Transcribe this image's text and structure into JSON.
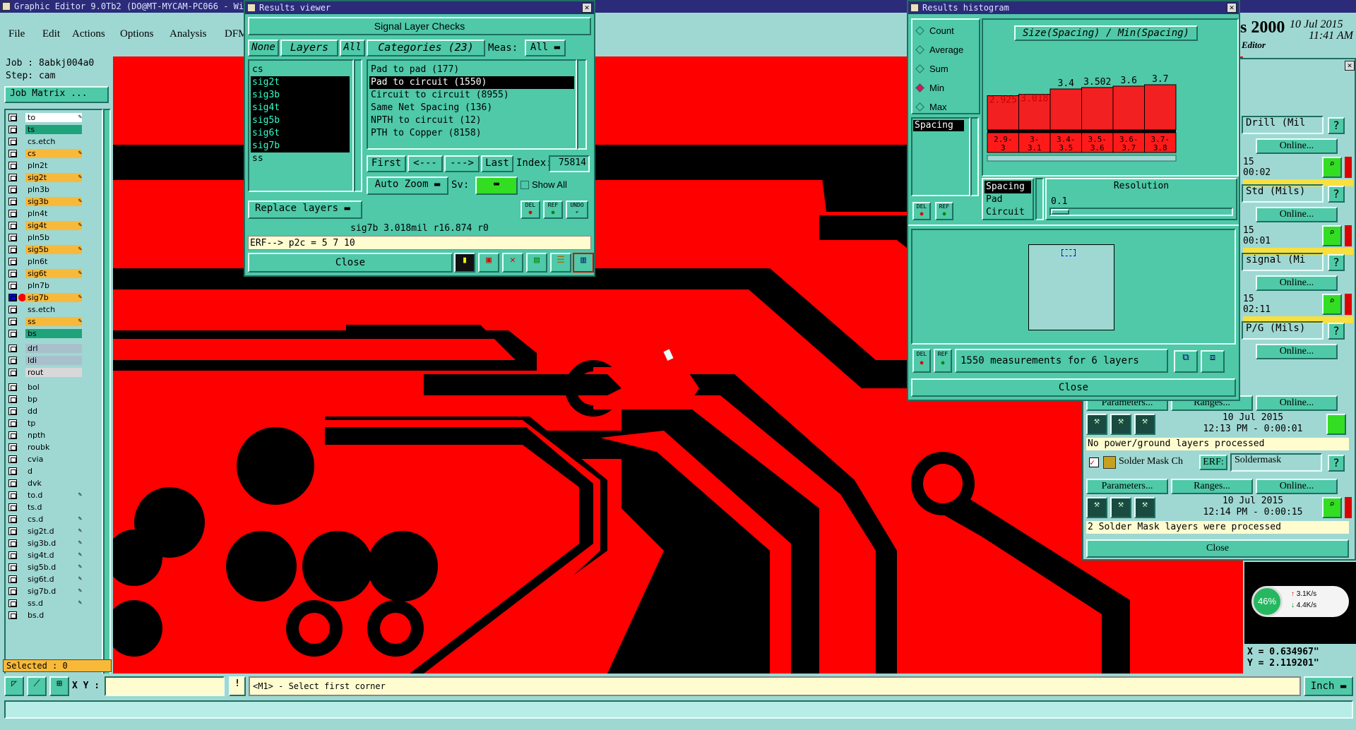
{
  "main_window": {
    "title": "Graphic Editor 9.0Tb2  (DO@MT-MYCAM-PC066 - Wi",
    "menus": [
      "File",
      "Edit",
      "Actions",
      "Options",
      "Analysis",
      "DFM"
    ],
    "brand_year": "s 2000",
    "brand_sub": "Editor",
    "date": "10 Jul 2015",
    "time": "11:41 AM"
  },
  "left_panel": {
    "job": "Job : 8abkj004a0",
    "step": "Step: cam",
    "job_matrix": "Job Matrix ...",
    "layers": [
      {
        "name": "to",
        "color": "#ffffff",
        "edit": true
      },
      {
        "name": "ts",
        "color": "#1fa37a",
        "edit": false
      },
      {
        "name": "cs.etch",
        "color": "#9fd8d3",
        "edit": false
      },
      {
        "name": "cs",
        "color": "#f8b93a",
        "edit": true
      },
      {
        "name": "pln2t",
        "color": "#9fd8d3",
        "edit": false
      },
      {
        "name": "sig2t",
        "color": "#f8b93a",
        "edit": true
      },
      {
        "name": "pln3b",
        "color": "#9fd8d3",
        "edit": false
      },
      {
        "name": "sig3b",
        "color": "#f8b93a",
        "edit": true
      },
      {
        "name": "pln4t",
        "color": "#9fd8d3",
        "edit": false
      },
      {
        "name": "sig4t",
        "color": "#f8b93a",
        "edit": true
      },
      {
        "name": "pln5b",
        "color": "#9fd8d3",
        "edit": false
      },
      {
        "name": "sig5b",
        "color": "#f8b93a",
        "edit": true
      },
      {
        "name": "pln6t",
        "color": "#9fd8d3",
        "edit": false
      },
      {
        "name": "sig6t",
        "color": "#f8b93a",
        "edit": true
      },
      {
        "name": "pln7b",
        "color": "#9fd8d3",
        "edit": false
      },
      {
        "name": "sig7b",
        "color": "#f8b93a",
        "edit": true
      },
      {
        "name": "ss.etch",
        "color": "#9fd8d3",
        "edit": false
      },
      {
        "name": "ss",
        "color": "#f8b93a",
        "edit": true
      },
      {
        "name": "bs",
        "color": "#1fa37a",
        "edit": false
      },
      {
        "name": "drl",
        "color": "#a8c0cc",
        "edit": false
      },
      {
        "name": "ldi",
        "color": "#a8c0cc",
        "edit": false
      },
      {
        "name": "rout",
        "color": "#d8d8d8",
        "edit": false
      },
      {
        "name": "bol",
        "color": "#9fd8d3",
        "edit": false
      },
      {
        "name": "bp",
        "color": "#9fd8d3",
        "edit": false
      },
      {
        "name": "dd",
        "color": "#9fd8d3",
        "edit": false
      },
      {
        "name": "tp",
        "color": "#9fd8d3",
        "edit": false
      },
      {
        "name": "npth",
        "color": "#9fd8d3",
        "edit": false
      },
      {
        "name": "roubk",
        "color": "#9fd8d3",
        "edit": false
      },
      {
        "name": "cvia",
        "color": "#9fd8d3",
        "edit": false
      },
      {
        "name": "d",
        "color": "#9fd8d3",
        "edit": false
      },
      {
        "name": "dvk",
        "color": "#9fd8d3",
        "edit": false
      },
      {
        "name": "to.d",
        "color": "#9fd8d3",
        "edit": true
      },
      {
        "name": "ts.d",
        "color": "#9fd8d3",
        "edit": false
      },
      {
        "name": "cs.d",
        "color": "#9fd8d3",
        "edit": true
      },
      {
        "name": "sig2t.d",
        "color": "#9fd8d3",
        "edit": true
      },
      {
        "name": "sig3b.d",
        "color": "#9fd8d3",
        "edit": true
      },
      {
        "name": "sig4t.d",
        "color": "#9fd8d3",
        "edit": true
      },
      {
        "name": "sig5b.d",
        "color": "#9fd8d3",
        "edit": true
      },
      {
        "name": "sig6t.d",
        "color": "#9fd8d3",
        "edit": true
      },
      {
        "name": "sig7b.d",
        "color": "#9fd8d3",
        "edit": true
      },
      {
        "name": "ss.d",
        "color": "#9fd8d3",
        "edit": true
      },
      {
        "name": "bs.d",
        "color": "#9fd8d3",
        "edit": false
      }
    ],
    "selected": "Selected : 0"
  },
  "results_viewer": {
    "title": "Results viewer",
    "heading": "Signal Layer Checks",
    "none_btn": "None",
    "layers_btn": "Layers",
    "all_btn": "All",
    "categories_btn": "Categories (23)",
    "meas_label": "Meas:",
    "meas_value": "All",
    "layers": [
      "cs",
      "sig2t",
      "sig3b",
      "sig4t",
      "sig5b",
      "sig6t",
      "sig7b",
      "ss"
    ],
    "categories": [
      "Pad to pad (177)",
      "Pad to circuit (1550)",
      "Circuit to circuit (8955)",
      "Same Net Spacing (136)",
      "NPTH to circuit (12)",
      "PTH to Copper (8158)"
    ],
    "first": "First",
    "prev": "<---",
    "next": "--->",
    "last": "Last",
    "index_label": "Index:",
    "index_value": "75814",
    "replace_layers": "Replace layers",
    "auto_zoom": "Auto Zoom",
    "sv_label": "Sv:",
    "show_all": "Show All",
    "del": "DEL",
    "ref": "REF",
    "undo": "UNDO",
    "status": "sig7b 3.018mil  r16.874  r0",
    "erf": "ERF--> p2c = 5 7 10",
    "close": "Close"
  },
  "histogram": {
    "title": "Results histogram",
    "options": [
      "Count",
      "Average",
      "Sum",
      "Min",
      "Max"
    ],
    "selected_option": "Min",
    "chart_title": "Size(Spacing) / Min(Spacing)",
    "list_selected": "Spacing",
    "list2": [
      "Spacing",
      "Pad",
      "Circuit"
    ],
    "resolution_label": "Resolution",
    "resolution_value": "0.1",
    "measurements": "1550 measurements for 6 layers",
    "del": "DEL",
    "ref": "REF",
    "close": "Close"
  },
  "chart_data": {
    "type": "bar",
    "title": "Size(Spacing) / Min(Spacing)",
    "categories": [
      "2.9-3",
      "3-3.1",
      "3.4-3.5",
      "3.5-3.6",
      "3.6-3.7",
      "3.7-3.8"
    ],
    "values": [
      2.925,
      3.018,
      3.4,
      3.502,
      3.6,
      3.7
    ],
    "value_labels": [
      "2.925",
      "3.018",
      "3.4",
      "3.502",
      "3.6",
      "3.7"
    ],
    "category_labels_top": [
      "2.9-",
      "3-",
      "3.4-",
      "3.5-",
      "3.6-",
      "3.7-"
    ],
    "category_labels_bottom": [
      "3",
      "3.1",
      "3.5",
      "3.6",
      "3.7",
      "3.8"
    ],
    "highlight_color": "#ff1a1a",
    "bar_color": "#f22020"
  },
  "checklist": {
    "rows": [
      {
        "title": "Drill (Mil",
        "online": "Online...",
        "date": "15",
        "time": "00:02"
      },
      {
        "title": "Std (Mils)",
        "online": "Online...",
        "date": "15",
        "time": "00:01"
      },
      {
        "title": "signal (Mi",
        "online": "Online...",
        "date": "15",
        "time": "02:11"
      },
      {
        "title": "P/G (Mils)",
        "online": "Online...",
        "date": "",
        "time": ""
      }
    ],
    "parameters": "Parameters...",
    "ranges": "Ranges...",
    "online": "Online...",
    "pg_date": "10 Jul 2015",
    "pg_time": "12:13 PM - 0:00:01",
    "pg_msg": "No power/ground layers processed",
    "sm_title": "Solder Mask Ch",
    "sm_erf": "ERF:",
    "sm_erf_val": "Soldermask",
    "sm_date": "10 Jul 2015",
    "sm_time": "12:14 PM - 0:00:15",
    "sm_msg": "2 Solder Mask layers were processed",
    "close": "Close",
    "help": "?"
  },
  "net_widget": {
    "percent": "46%",
    "up": "3.1K/s",
    "down": "4.4K/s"
  },
  "coords": {
    "x": "X = 0.634967\"",
    "y": "Y = 2.119201\""
  },
  "bottom_bar": {
    "xy_label": "X Y :",
    "xy_value": "",
    "prompt": "<M1> - Select first corner",
    "units": "Inch"
  }
}
